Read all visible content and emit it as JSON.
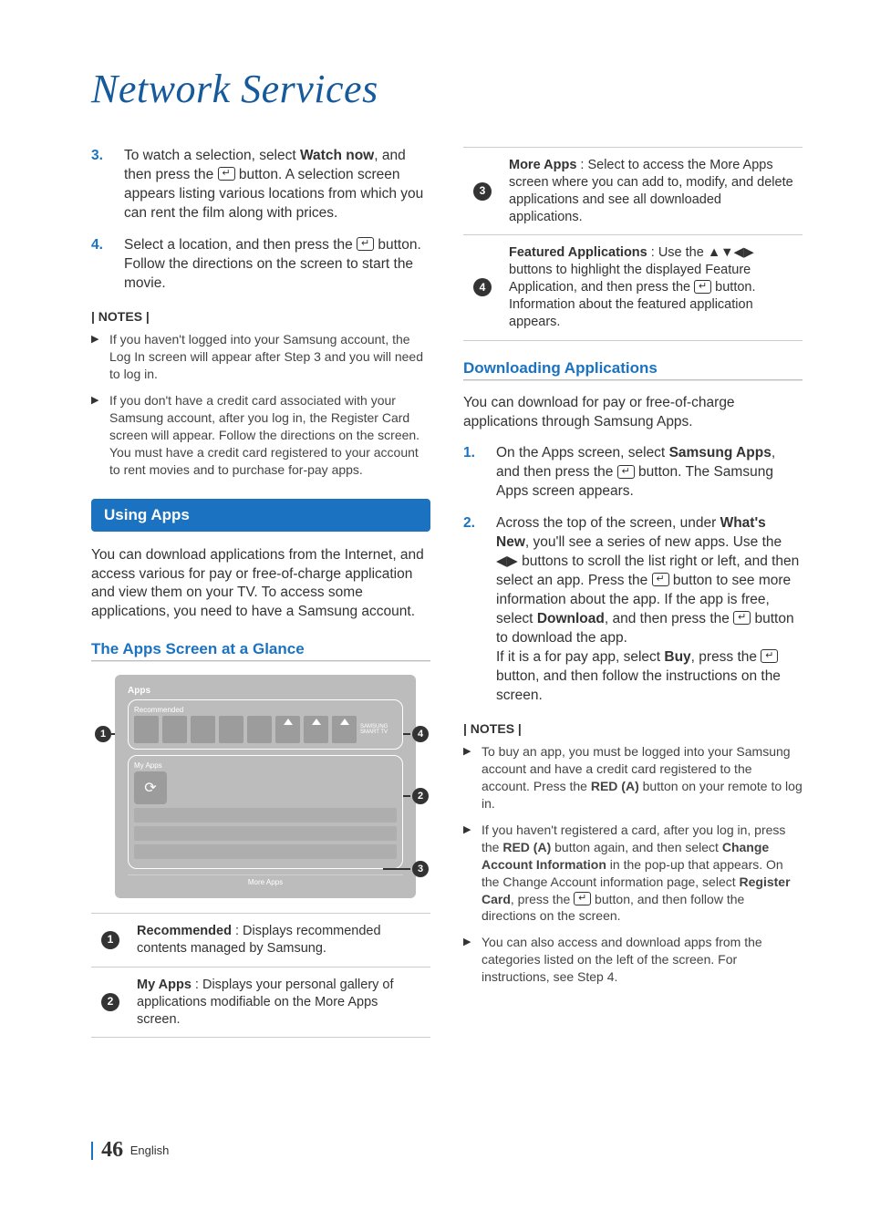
{
  "page_title": "Network Services",
  "left": {
    "steps": [
      {
        "num": "3.",
        "before": "To watch a selection, select ",
        "bold": "Watch now",
        "after": ", and then press the ",
        "icon": true,
        "tail": " button. A selection screen appears listing various locations from which you can rent the film along with prices."
      },
      {
        "num": "4.",
        "before": "Select a location, and then press the ",
        "bold": "",
        "after": "",
        "icon": true,
        "tail": " button. Follow the directions on the screen to start the movie."
      }
    ],
    "notes_header": "| NOTES |",
    "notes": [
      "If you haven't logged into your Samsung account, the Log In screen will appear after Step 3 and you will need to log in.",
      "If you don't have a credit card associated with your Samsung account, after you log in, the Register Card screen will appear. Follow the directions on the screen. You must have a credit card registered to your account to rent movies and to purchase for-pay apps."
    ],
    "section_bar": "Using Apps",
    "using_apps_para": "You can download applications from the Internet, and access various for pay or free-of-charge application and view them on your TV. To access some applications, you need to have a Samsung account.",
    "sub_header": "The Apps Screen at a Glance",
    "mini": {
      "title": "Apps",
      "recommended_label": "Recommended",
      "myapps_label": "My Apps",
      "more_apps": "More Apps",
      "brand": "SAMSUNG SMART TV"
    },
    "callout_table": [
      {
        "n": "1",
        "bold": "Recommended",
        "text": " : Displays recommended contents managed by Samsung."
      },
      {
        "n": "2",
        "bold": "My Apps",
        "text": " : Displays your personal gallery of applications modifiable on the More Apps screen."
      }
    ]
  },
  "right": {
    "callout_table": [
      {
        "n": "3",
        "bold": "More Apps",
        "text": " : Select to access the More Apps screen where you can add to, modify, and delete applications and see all downloaded applications."
      },
      {
        "n": "4",
        "bold": "Featured Applications",
        "text_before": " : Use the ",
        "arrows": "▲▼◀▶",
        "text_mid": " buttons to highlight the displayed Feature Application, and then press the ",
        "icon": true,
        "text_after": " button. Information about the featured application appears."
      }
    ],
    "sub_header": "Downloading Applications",
    "para": "You can download for pay or free-of-charge applications through Samsung Apps.",
    "steps": [
      {
        "num": "1.",
        "parts": [
          {
            "t": "On the Apps screen, select "
          },
          {
            "b": "Samsung Apps"
          },
          {
            "t": ", and then press the "
          },
          {
            "icon": true
          },
          {
            "t": " button. The Samsung Apps screen appears."
          }
        ]
      },
      {
        "num": "2.",
        "parts": [
          {
            "t": "Across the top of the screen, under "
          },
          {
            "b": "What's New"
          },
          {
            "t": ", you'll see a series of new apps. Use the "
          },
          {
            "arrows": "◀▶"
          },
          {
            "t": " buttons to scroll the list right or left, and then select an app. Press the "
          },
          {
            "icon": true
          },
          {
            "t": " button to see more information about the app. If the app is free, select "
          },
          {
            "b": "Download"
          },
          {
            "t": ", and then press the "
          },
          {
            "icon": true
          },
          {
            "t": " button to download the app."
          },
          {
            "br": true
          },
          {
            "t": "If it is a for pay app, select "
          },
          {
            "b": "Buy"
          },
          {
            "t": ", press the "
          },
          {
            "icon": true
          },
          {
            "t": " button, and then follow the instructions on the screen."
          }
        ]
      }
    ],
    "notes_header": "| NOTES |",
    "notes": [
      {
        "parts": [
          {
            "t": "To buy an app, you must be logged into your Samsung account and have a credit card registered to the account. Press the "
          },
          {
            "b": "RED (A)"
          },
          {
            "t": " button on your remote to log in."
          }
        ]
      },
      {
        "parts": [
          {
            "t": "If you haven't registered a card, after you log in, press the "
          },
          {
            "b": "RED (A)"
          },
          {
            "t": " button again, and then select "
          },
          {
            "b": "Change Account Information"
          },
          {
            "t": " in the pop-up that appears. On the Change Account information page, select "
          },
          {
            "b": "Register Card"
          },
          {
            "t": ", press the "
          },
          {
            "icon": true
          },
          {
            "t": " button, and then follow the directions on the screen."
          }
        ]
      },
      {
        "parts": [
          {
            "t": "You can also access and download apps from the categories listed on the left of the screen. For instructions, see Step 4."
          }
        ]
      }
    ]
  },
  "footer": {
    "page": "46",
    "lang": "English"
  }
}
